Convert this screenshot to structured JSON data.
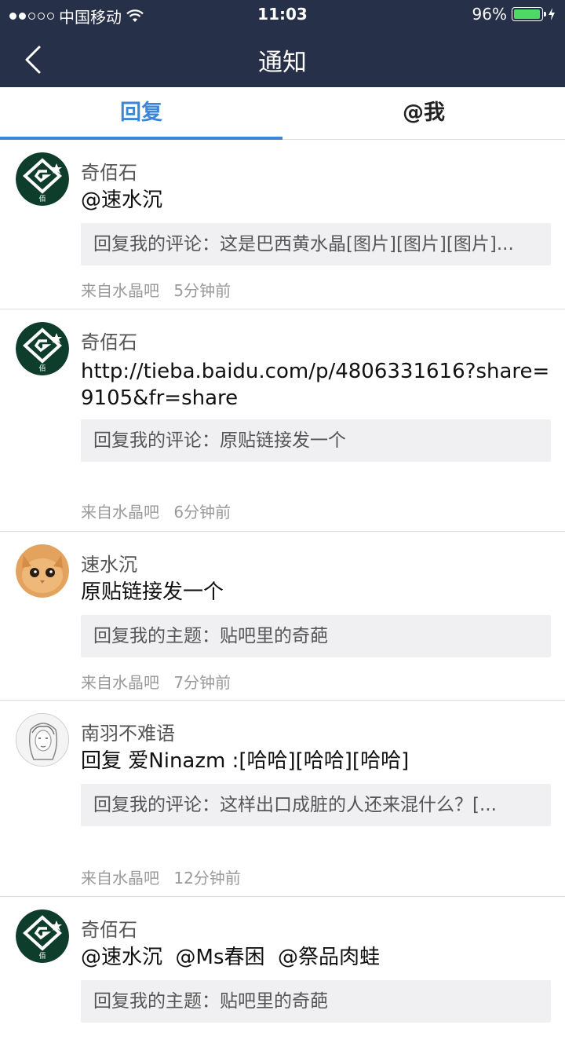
{
  "status_bar": {
    "carrier": "中国移动",
    "time": "11:03",
    "battery_percent": "96%",
    "battery_level": 0.96,
    "battery_color": "#4cd964",
    "signal_bars": 2
  },
  "header": {
    "title": "通知",
    "back_icon": "chevron-left-icon",
    "background": "#273049"
  },
  "tabs": [
    {
      "label": "回复",
      "active": true
    },
    {
      "label": "@我",
      "active": false
    }
  ],
  "accent": "#3a86d9",
  "notifications": [
    {
      "avatar": "green-logo-avatar",
      "user": "奇佰石",
      "content": "@速水沉",
      "quote": "回复我的评论：这是巴西黄水晶[图片][图片][图片]...",
      "source": "来自水晶吧",
      "time": "5分钟前"
    },
    {
      "avatar": "green-logo-avatar",
      "user": "奇佰石",
      "content": "http://tieba.baidu.com/p/4806331616?share=9105&fr=share",
      "quote": "回复我的评论：原贴链接发一个",
      "source": "来自水晶吧",
      "time": "6分钟前"
    },
    {
      "avatar": "cat-avatar",
      "user": "速水沉",
      "content": "原贴链接发一个",
      "quote": "回复我的主题：贴吧里的奇葩",
      "source": "来自水晶吧",
      "time": "7分钟前"
    },
    {
      "avatar": "sketch-portrait-avatar",
      "user": "南羽不难语",
      "content": "回复 爱Ninazm :[哈哈][哈哈][哈哈]",
      "quote": "回复我的评论：这样出口成脏的人还来混什么？[...",
      "source": "来自水晶吧",
      "time": "12分钟前"
    },
    {
      "avatar": "green-logo-avatar",
      "user": "奇佰石",
      "content": "@速水沉  @Ms春困  @祭品肉蛙",
      "quote": "回复我的主题：贴吧里的奇葩",
      "source": "",
      "time": ""
    }
  ]
}
